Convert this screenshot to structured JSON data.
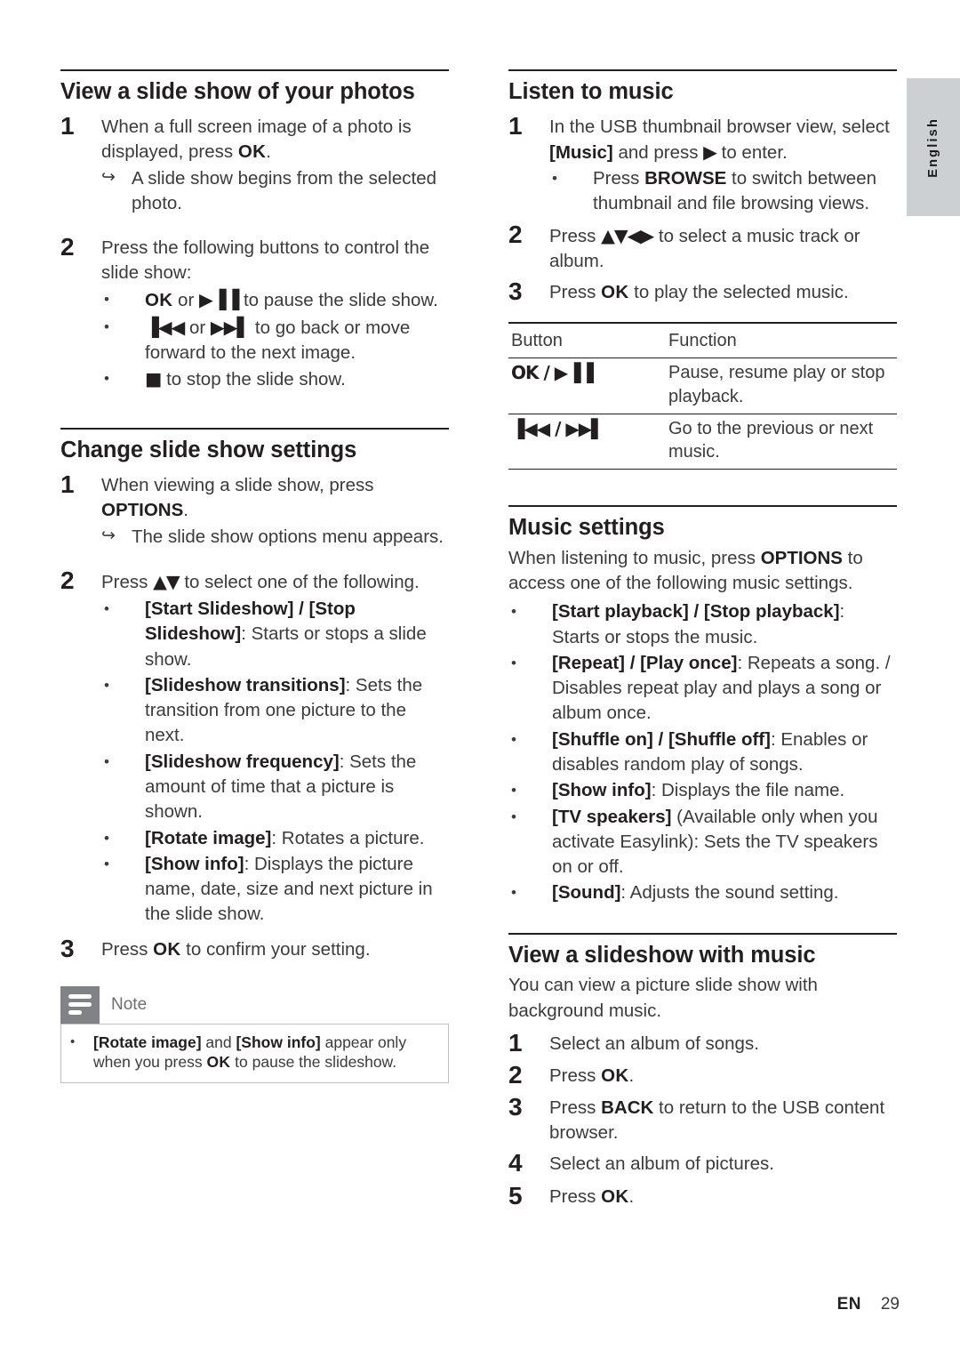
{
  "sidebar_tab": {
    "language_label": "English"
  },
  "footer": {
    "lang_code": "EN",
    "page_number": "29"
  },
  "left_column": {
    "section_photos": {
      "title": "View a slide show of your photos",
      "steps": [
        {
          "number": "1",
          "text_before": "When a full screen image of a photo is displayed, press ",
          "bold": "OK",
          "text_after": ".",
          "result": "A slide show begins from the selected photo."
        },
        {
          "number": "2",
          "text": "Press the following buttons to control the slide show:"
        }
      ],
      "bullets": [
        {
          "bold_lead": "OK",
          "mid": " or ",
          "glyph": "▶▐▐",
          "tail": " to pause the slide show."
        },
        {
          "glyph_lead": "▐◀◀",
          "mid": " or ",
          "glyph2": "▶▶▌",
          "tail": " to go back or move forward to the next image."
        },
        {
          "glyph_lead": "■",
          "tail": " to stop the slide show."
        }
      ]
    },
    "section_settings": {
      "title": "Change slide show settings",
      "step1": {
        "number": "1",
        "text_before": "When viewing a slide show, press ",
        "bold": "OPTIONS",
        "text_after": ".",
        "result": "The slide show options menu appears."
      },
      "step2": {
        "number": "2",
        "text_before": "Press ",
        "glyph": "▲▼",
        "text_after": " to select one of the following."
      },
      "options": [
        {
          "bold": "[Start Slideshow] / [Stop Slideshow]",
          "rest": ": Starts or stops a slide show."
        },
        {
          "bold": "[Slideshow transitions]",
          "rest": ": Sets the transition from one picture to the next."
        },
        {
          "bold": "[Slideshow frequency]",
          "rest": ": Sets the amount of time that a picture is shown."
        },
        {
          "bold": "[Rotate image]",
          "rest": ": Rotates a picture."
        },
        {
          "bold": "[Show info]",
          "rest": ": Displays the picture name, date, size and next picture in the slide show."
        }
      ],
      "step3": {
        "number": "3",
        "text_before": "Press ",
        "bold": "OK",
        "text_after": " to confirm your setting."
      }
    },
    "note": {
      "title": "Note",
      "bullet": {
        "b1": "[Rotate image]",
        "t1": " and ",
        "b2": "[Show info]",
        "t2": " appear only when you press ",
        "b3": "OK",
        "t3": " to pause the slideshow."
      }
    }
  },
  "right_column": {
    "section_listen": {
      "title": "Listen to music",
      "step1": {
        "number": "1",
        "text_before": "In the USB thumbnail browser view, select ",
        "bold": "[Music]",
        "text_mid": " and press ",
        "glyph": "▶",
        "text_after": " to enter."
      },
      "step1_bullet": {
        "text_before": "Press ",
        "bold": "BROWSE",
        "text_after": " to switch between thumbnail and file browsing views."
      },
      "step2": {
        "number": "2",
        "text_before": "Press ",
        "glyph": "▲▼◀▶",
        "text_after": " to select a music track or album."
      },
      "step3": {
        "number": "3",
        "text_before": "Press ",
        "bold": "OK",
        "text_after": " to play the selected music."
      }
    },
    "button_table": {
      "headers": [
        "Button",
        "Function"
      ],
      "rows": [
        {
          "button": "OK / ▶▐▐",
          "function": "Pause, resume play or stop playback."
        },
        {
          "button": "▐◀◀ / ▶▶▌",
          "function": "Go to the previous or next music."
        }
      ]
    },
    "section_music_settings": {
      "title": "Music settings",
      "intro_before": "When listening to music, press ",
      "intro_bold": "OPTIONS",
      "intro_after": " to access one of the following music settings.",
      "options": [
        {
          "bold": "[Start playback] / [Stop playback]",
          "rest": ": Starts or stops the music."
        },
        {
          "bold": "[Repeat] / [Play once]",
          "rest": ": Repeats a song. / Disables repeat play and plays a song or album once."
        },
        {
          "bold": "[Shuffle on] / [Shuffle off]",
          "rest": ": Enables or disables random play of songs."
        },
        {
          "bold": "[Show info]",
          "rest": ": Displays the file name."
        },
        {
          "bold": "[TV speakers]",
          "rest": " (Available only when you activate Easylink): Sets the TV speakers on or off."
        },
        {
          "bold": "[Sound]",
          "rest": ": Adjusts the sound setting."
        }
      ]
    },
    "section_slideshow_music": {
      "title": "View a slideshow with music",
      "intro": "You can view a picture slide show with background music.",
      "steps": [
        {
          "number": "1",
          "text": "Select an album of songs."
        },
        {
          "number": "2",
          "text_before": "Press ",
          "bold": "OK",
          "text_after": "."
        },
        {
          "number": "3",
          "text_before": "Press ",
          "bold": "BACK",
          "text_after": " to return to the USB content browser."
        },
        {
          "number": "4",
          "text": "Select an album of pictures."
        },
        {
          "number": "5",
          "text_before": "Press ",
          "bold": "OK",
          "text_after": "."
        }
      ]
    }
  }
}
